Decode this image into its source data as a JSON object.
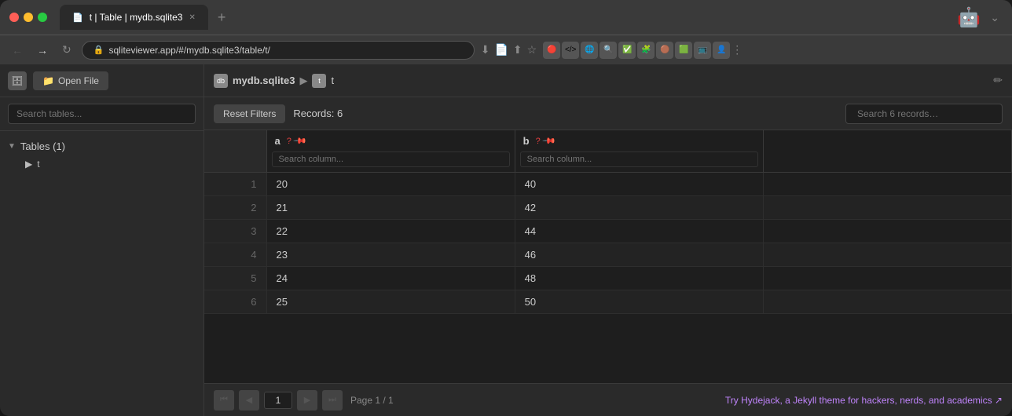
{
  "window": {
    "title": "t | Table | mydb.sqlite3"
  },
  "titlebar": {
    "tab_label": "t | Table | mydb.sqlite3",
    "tab_icon": "📄",
    "new_tab_label": "+",
    "chevron_down": "⌄"
  },
  "addressbar": {
    "url": "sqliteviewer.app/#/mydb.sqlite3/table/t/",
    "back_label": "←",
    "forward_label": "→",
    "reload_label": "↻"
  },
  "sidebar": {
    "open_file_label": "Open File",
    "search_placeholder": "Search tables...",
    "tables_header": "Tables (1)",
    "table_item": "t"
  },
  "breadcrumb": {
    "db_name": "mydb.sqlite3",
    "separator": "▶",
    "table_name": "t"
  },
  "toolbar": {
    "reset_filters_label": "Reset Filters",
    "records_count": "Records: 6",
    "search_placeholder": "Search 6 records…"
  },
  "columns": [
    {
      "name": "a",
      "search_placeholder": "Search column...",
      "has_type_icon": true,
      "has_pin_icon": true
    },
    {
      "name": "b",
      "search_placeholder": "Search column...",
      "has_type_icon": true,
      "has_pin_icon": true
    }
  ],
  "rows": [
    {
      "row_num": "1",
      "a": "20",
      "b": "40"
    },
    {
      "row_num": "2",
      "a": "21",
      "b": "42"
    },
    {
      "row_num": "3",
      "a": "22",
      "b": "44"
    },
    {
      "row_num": "4",
      "a": "23",
      "b": "46"
    },
    {
      "row_num": "5",
      "a": "24",
      "b": "48"
    },
    {
      "row_num": "6",
      "a": "25",
      "b": "50"
    }
  ],
  "pagination": {
    "current_page": "1",
    "page_info": "Page 1 / 1",
    "first_label": "⏮",
    "prev_label": "◀",
    "next_label": "▶",
    "last_label": "⏭"
  },
  "footer": {
    "hydejack_text": "Try Hydejack, a Jekyll theme for hackers, nerds, and academics ↗"
  }
}
